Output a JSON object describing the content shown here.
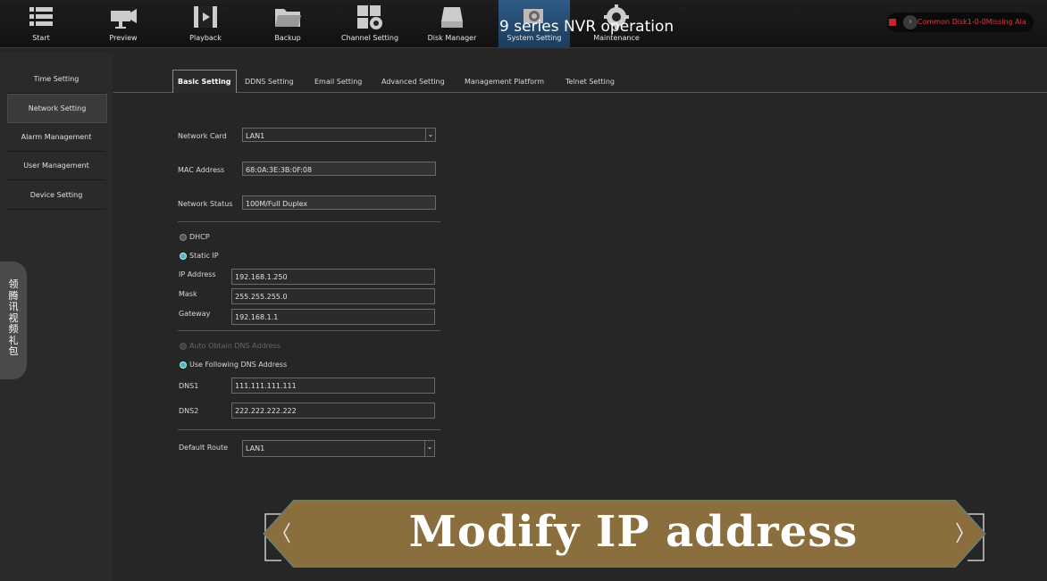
{
  "nav": {
    "items": [
      {
        "label": "Start",
        "icon": "list-icon"
      },
      {
        "label": "Preview",
        "icon": "camera-icon"
      },
      {
        "label": "Playback",
        "icon": "film-icon"
      },
      {
        "label": "Backup",
        "icon": "folder-icon"
      },
      {
        "label": "Channel Setting",
        "icon": "channel-gear-icon"
      },
      {
        "label": "Disk Manager",
        "icon": "disk-icon"
      },
      {
        "label": "System Setting",
        "icon": "system-gear-icon"
      },
      {
        "label": "Maintenance",
        "icon": "gear-icon"
      }
    ],
    "overlay_title": "9 series NVR operation",
    "alarm_text": "Common Disk1-0-0Missing Ala"
  },
  "sidebar": {
    "items": [
      {
        "label": "Time Setting"
      },
      {
        "label": "Network Setting"
      },
      {
        "label": "Alarm Management"
      },
      {
        "label": "User Management"
      },
      {
        "label": "Device Setting"
      }
    ],
    "vertical_tab": "领\n腾\n讯\n视\n频\n礼\n包"
  },
  "tabs": [
    {
      "label": "Basic Setting"
    },
    {
      "label": "DDNS Setting"
    },
    {
      "label": "Email Setting"
    },
    {
      "label": "Advanced Setting"
    },
    {
      "label": "Management Platform"
    },
    {
      "label": "Telnet Setting"
    }
  ],
  "form": {
    "network_card": {
      "label": "Network Card",
      "value": "LAN1"
    },
    "mac_address": {
      "label": "MAC Address",
      "value": "68:0A:3E:3B:0F:08"
    },
    "network_status": {
      "label": "Network Status",
      "value": "100M/Full Duplex"
    },
    "dhcp": {
      "label": "DHCP"
    },
    "static_ip": {
      "label": "Static IP"
    },
    "ip_address": {
      "label": "IP Address",
      "value": "192.168.1.250"
    },
    "mask": {
      "label": "Mask",
      "value": "255.255.255.0"
    },
    "gateway": {
      "label": "Gateway",
      "value": "192.168.1.1"
    },
    "auto_dns": {
      "label": "Auto Obtain DNS Address"
    },
    "manual_dns": {
      "label": "Use Following DNS Address"
    },
    "dns1": {
      "label": "DNS1",
      "value": "111.111.111.111"
    },
    "dns2": {
      "label": "DNS2",
      "value": "222.222.222.222"
    },
    "default_route": {
      "label": "Default Route",
      "value": "LAN1"
    }
  },
  "banner": {
    "text": "Modify IP address"
  },
  "colors": {
    "accent": "#2e5b86",
    "banner": "#8a6e3e",
    "alarm": "#e0393e"
  }
}
